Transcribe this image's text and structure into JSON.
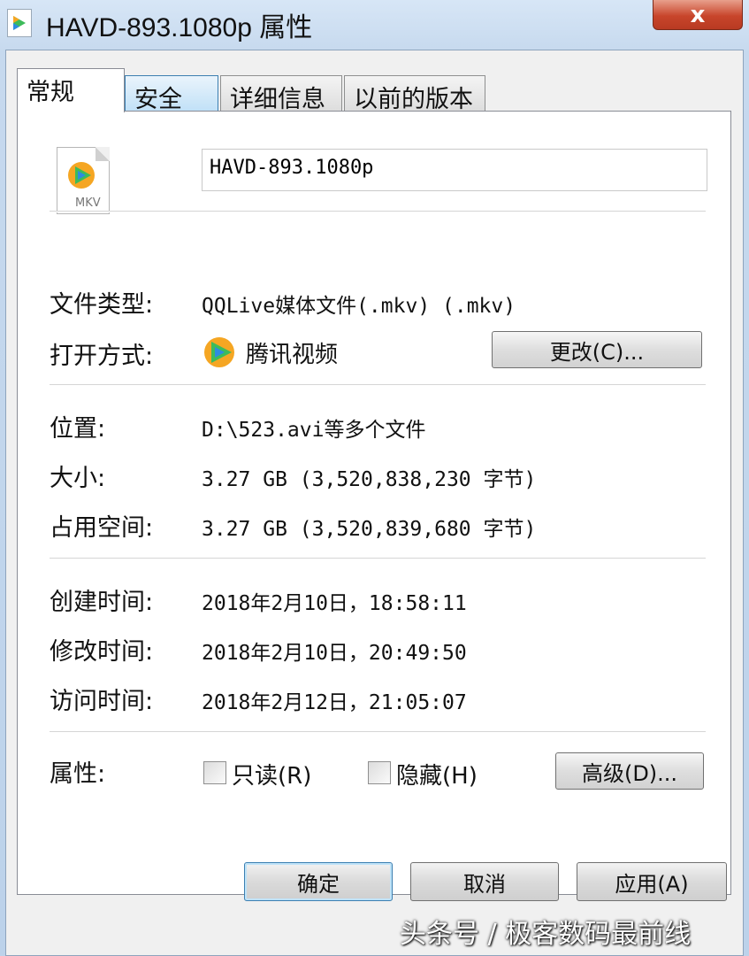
{
  "window": {
    "title": "HAVD-893.1080p 属性",
    "close_label": "x"
  },
  "tabs": [
    {
      "label": "常规",
      "active": true
    },
    {
      "label": "安全",
      "active": false
    },
    {
      "label": "详细信息",
      "active": false
    },
    {
      "label": "以前的版本",
      "active": false
    }
  ],
  "general": {
    "file_icon_ext": "MKV",
    "filename": "HAVD-893.1080p",
    "type_label": "文件类型:",
    "type_value": "QQLive媒体文件(.mkv) (.mkv)",
    "open_with_label": "打开方式:",
    "open_with_value": "腾讯视频",
    "change_button": "更改(C)...",
    "location_label": "位置:",
    "location_value": "D:\\523.avi等多个文件",
    "size_label": "大小:",
    "size_value": "3.27 GB (3,520,838,230 字节)",
    "size_on_disk_label": "占用空间:",
    "size_on_disk_value": "3.27 GB (3,520,839,680 字节)",
    "created_label": "创建时间:",
    "created_value": "2018年2月10日，18:58:11",
    "modified_label": "修改时间:",
    "modified_value": "2018年2月10日，20:49:50",
    "accessed_label": "访问时间:",
    "accessed_value": "2018年2月12日，21:05:07",
    "attributes_label": "属性:",
    "readonly_label": "只读(R)",
    "hidden_label": "隐藏(H)",
    "advanced_button": "高级(D)..."
  },
  "footer": {
    "ok": "确定",
    "cancel": "取消",
    "apply": "应用(A)"
  },
  "watermark": "头条号 / 极客数码最前线",
  "colors": {
    "close_red": "#c8452b",
    "frame_blue": "#c6d9ee",
    "tencent_orange": "#f5a623",
    "tencent_green": "#3dbb5a",
    "tencent_blue": "#2d8ce0"
  }
}
